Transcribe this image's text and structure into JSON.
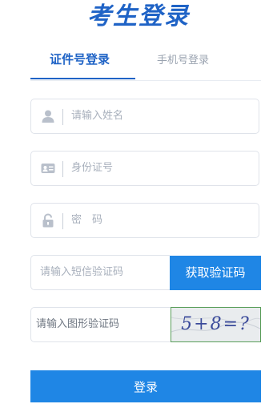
{
  "header": {
    "title": "考生登录"
  },
  "tabs": [
    {
      "label": "证件号登录",
      "active": true
    },
    {
      "label": "手机号登录",
      "active": false
    }
  ],
  "form": {
    "name_placeholder": "请输入姓名",
    "id_placeholder": "身份证号",
    "password_placeholder": "密　码",
    "sms_placeholder": "请输入短信验证码",
    "sms_button": "获取验证码",
    "captcha_placeholder": "请输入图形验证码",
    "captcha_image_text": "5+8=?",
    "login_button": "登录"
  },
  "colors": {
    "accent": "#1f86e5",
    "title": "#1f63c6",
    "border": "#dfe3ea",
    "placeholder": "#a8b0bc"
  },
  "icons": [
    "user-icon",
    "id-card-icon",
    "lock-icon"
  ]
}
